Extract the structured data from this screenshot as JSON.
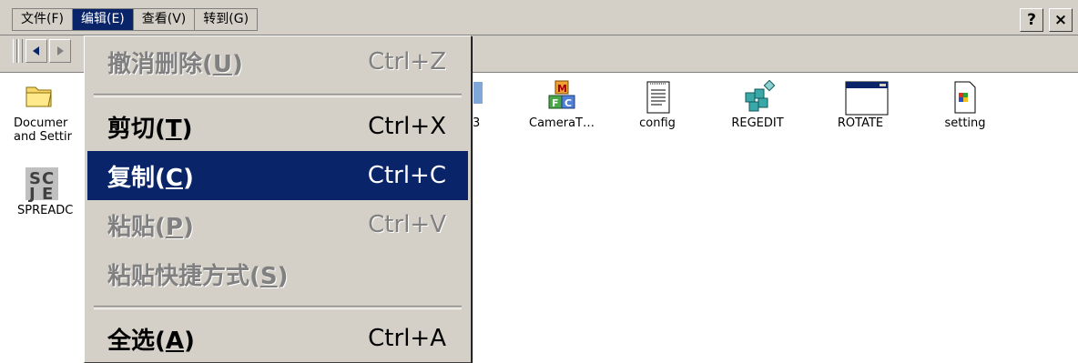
{
  "menubar": {
    "items": [
      {
        "label": "文件(F)"
      },
      {
        "label": "编辑(E)"
      },
      {
        "label": "查看(V)"
      },
      {
        "label": "转到(G)"
      }
    ],
    "help_label": "?",
    "close_label": "×"
  },
  "desktop": {
    "icons": [
      {
        "label1": "Documer",
        "label2": "and Settir",
        "icon": "folder-icon"
      },
      {
        "label1": "SPREADC",
        "icon": "spreadsheet-app-icon"
      },
      {
        "label1": "3",
        "icon": "partial-icon"
      },
      {
        "label1": "CameraT…",
        "icon": "camera-tool-icon"
      },
      {
        "label1": "config",
        "icon": "text-file-icon"
      },
      {
        "label1": "REGEDIT",
        "icon": "registry-editor-icon"
      },
      {
        "label1": "ROTATE",
        "icon": "window-app-icon"
      },
      {
        "label1": "setting",
        "icon": "settings-file-icon"
      }
    ]
  },
  "dropdown": {
    "items": [
      {
        "label": "撤消删除(",
        "key": "U",
        "label_end": ")",
        "shortcut": "Ctrl+Z",
        "state": "disabled"
      },
      {
        "label": "剪切(",
        "key": "T",
        "label_end": ")",
        "shortcut": "Ctrl+X",
        "state": "enabled"
      },
      {
        "label": "复制(",
        "key": "C",
        "label_end": ")",
        "shortcut": "Ctrl+C",
        "state": "selected"
      },
      {
        "label": "粘贴(",
        "key": "P",
        "label_end": ")",
        "shortcut": "Ctrl+V",
        "state": "disabled"
      },
      {
        "label": "粘贴快捷方式(",
        "key": "S",
        "label_end": ")",
        "shortcut": "",
        "state": "disabled"
      },
      {
        "label": "全选(",
        "key": "A",
        "label_end": ")",
        "shortcut": "Ctrl+A",
        "state": "enabled"
      }
    ]
  },
  "colors": {
    "highlight": "#0a246a",
    "face": "#d4d0c8",
    "disabled_text": "#808080"
  }
}
